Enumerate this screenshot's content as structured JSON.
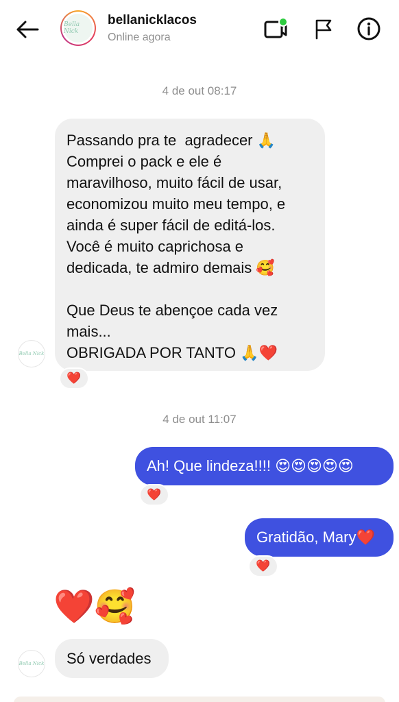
{
  "header": {
    "username": "bellanicklacos",
    "status": "Online agora",
    "avatar_text": "Bella Nick",
    "icons": [
      "back-arrow-icon",
      "video-call-icon",
      "flag-icon",
      "info-icon"
    ],
    "online_color": "#2ecc40"
  },
  "messages": {
    "timestamp_1": "4 de out 08:17",
    "incoming_1": {
      "lines": [
        "Passando pra te  agradecer 🙏",
        "Comprei o pack e ele é",
        "maravilhoso, muito fácil de usar,",
        "economizou muito meu tempo, e",
        "ainda é super fácil de editá-los.",
        "Você é muito caprichosa e",
        "dedicada, te admiro demais 🥰",
        " ",
        "Que Deus te abençoe cada vez",
        "mais...",
        "OBRIGADA POR TANTO 🙏❤️"
      ],
      "reaction": "❤️"
    },
    "timestamp_2": "4 de out 11:07",
    "outgoing_1": {
      "text": "Ah! Que lindeza!!!! 😍😍😍😍😍",
      "reaction": "❤️"
    },
    "outgoing_2": {
      "text": "Gratidão, Mary❤️",
      "reaction": "❤️"
    },
    "incoming_emoji": "❤️🥰",
    "incoming_2": {
      "text": "Só verdades"
    }
  },
  "colors": {
    "outgoing_bubble": "#3f51e0",
    "incoming_bubble": "#efefef",
    "heart": "#e0192f"
  }
}
